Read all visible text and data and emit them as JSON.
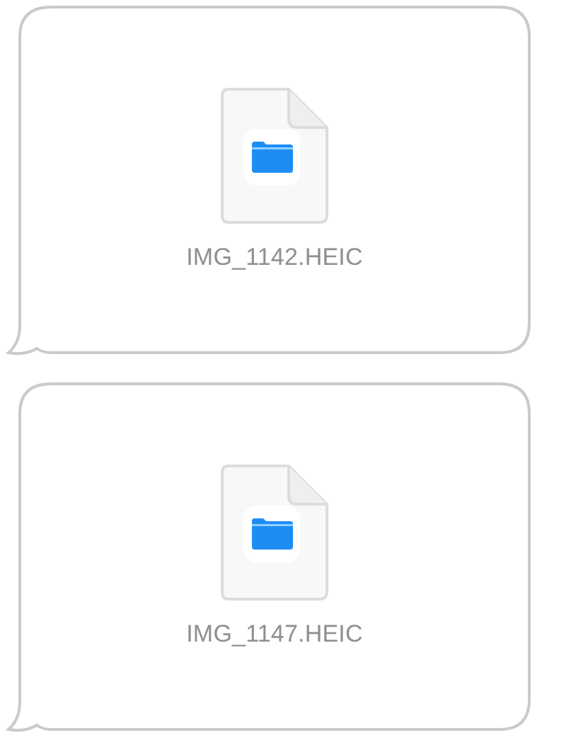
{
  "messages": [
    {
      "kind": "file",
      "filename": "IMG_1142.HEIC"
    },
    {
      "kind": "file",
      "filename": "IMG_1147.HEIC"
    }
  ]
}
